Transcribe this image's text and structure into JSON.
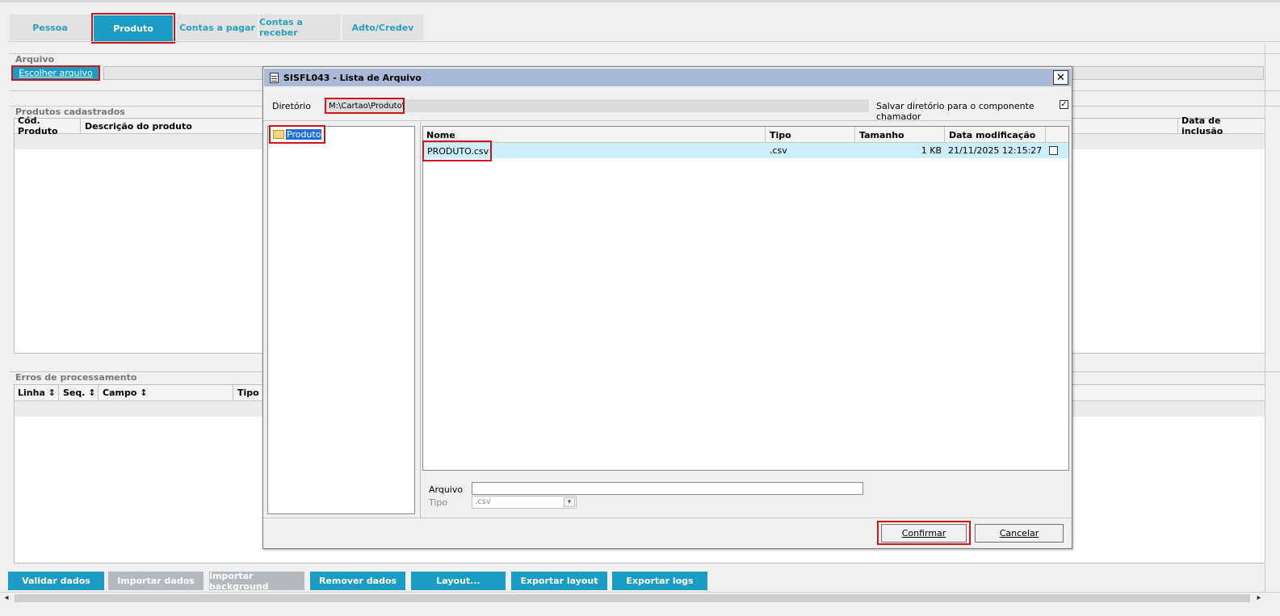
{
  "tabs": [
    {
      "label": "Pessoa"
    },
    {
      "label": "Produto"
    },
    {
      "label": "Contas a pagar"
    },
    {
      "label": "Contas a receber"
    },
    {
      "label": "Adto/Credev"
    }
  ],
  "arquivo": {
    "section_title": "Arquivo",
    "choose_button": "Escolher arquivo"
  },
  "produtos": {
    "section_title": "Produtos cadastrados",
    "columns": [
      "Cód. Produto",
      "Descrição do produto",
      "Data de inclusão"
    ]
  },
  "erros": {
    "section_title": "Erros de processamento",
    "columns": [
      "Linha",
      "Seq.",
      "Campo",
      "Tipo d"
    ],
    "sort_glyph": "↕"
  },
  "bottom_buttons": [
    {
      "label": "Validar dados",
      "state": "enabled"
    },
    {
      "label": "Importar dados",
      "state": "disabled"
    },
    {
      "label": "Importar background",
      "state": "disabled"
    },
    {
      "label": "Remover dados",
      "state": "enabled"
    },
    {
      "label": "Layout...",
      "state": "enabled"
    },
    {
      "label": "Exportar layout",
      "state": "enabled"
    },
    {
      "label": "Exportar logs",
      "state": "enabled"
    }
  ],
  "dialog": {
    "title": "SISFL043 - Lista de Arquivo",
    "close_glyph": "✕",
    "dir_label": "Diretório",
    "dir_value": "M:\\Cartao\\Produto\\",
    "save_dir_label": "Salvar diretório para o componente chamador",
    "save_dir_checked": "✓",
    "tree_folder": "Produto",
    "file_columns": [
      "Nome",
      "Tipo",
      "Tamanho",
      "Data modificação"
    ],
    "files": [
      {
        "name": "PRODUTO.csv",
        "type": ".csv",
        "size": "1 KB",
        "modified": "21/11/2025 12:15:27"
      }
    ],
    "arquivo_label": "Arquivo",
    "arquivo_value": "",
    "tipo_label": "Tipo",
    "tipo_value": ".csv",
    "dropdown_glyph": "▾",
    "confirm_label": "Confirmar",
    "cancel_label": "Cancelar"
  },
  "scrollbar": {
    "left_glyph": "◂",
    "right_glyph": "▸"
  },
  "colors": {
    "accent": "#1a9cc5",
    "highlight": "#d0141c",
    "title_bar": "#a9b9d6",
    "selected_row": "#cdeefb"
  }
}
